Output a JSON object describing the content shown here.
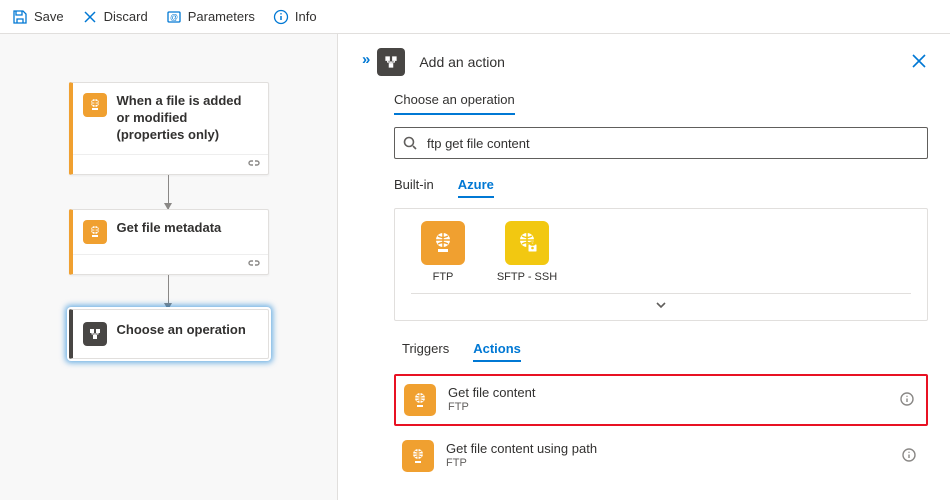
{
  "toolbar": {
    "save": "Save",
    "discard": "Discard",
    "parameters": "Parameters",
    "info": "Info"
  },
  "canvas": {
    "trigger": {
      "title": "When a file is added or modified (properties only)"
    },
    "action1": {
      "title": "Get file metadata"
    },
    "placeholder": {
      "title": "Choose an operation"
    }
  },
  "panel": {
    "title": "Add an action",
    "section": "Choose an operation",
    "search_value": "ftp get file content",
    "tabs": {
      "builtin": "Built-in",
      "azure": "Azure"
    },
    "connectors": [
      {
        "name": "FTP",
        "color": "orange"
      },
      {
        "name": "SFTP - SSH",
        "color": "yellow"
      }
    ],
    "subtabs": {
      "triggers": "Triggers",
      "actions": "Actions"
    },
    "actions": [
      {
        "title": "Get file content",
        "subtitle": "FTP",
        "highlight": true
      },
      {
        "title": "Get file content using path",
        "subtitle": "FTP",
        "highlight": false
      }
    ]
  }
}
